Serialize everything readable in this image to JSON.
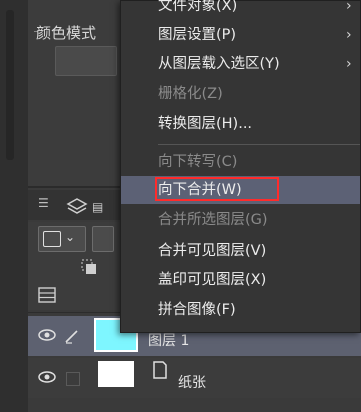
{
  "property_panel": {
    "color_mode_label": "颜色模式"
  },
  "layer_panel": {
    "layers": [
      {
        "name": "图层 1",
        "selected": true,
        "thumbnail_color": "#7ef6ff",
        "visible": true
      },
      {
        "name": "纸张",
        "selected": false,
        "thumbnail_color": "#ffffff",
        "visible": true
      }
    ]
  },
  "context_menu": {
    "items": [
      {
        "label": "文件对象(X)",
        "enabled": true,
        "submenu": true
      },
      {
        "label": "图层设置(P)",
        "enabled": true,
        "submenu": true
      },
      {
        "label": "从图层载入选区(Y)",
        "enabled": true,
        "submenu": true
      },
      {
        "label": "栅格化(Z)",
        "enabled": false,
        "submenu": false
      },
      {
        "label": "转换图层(H)...",
        "enabled": true,
        "submenu": false
      },
      {
        "label": "向下转写(C)",
        "enabled": false,
        "submenu": false
      },
      {
        "label": "向下合并(W)",
        "enabled": true,
        "submenu": false,
        "highlighted": true
      },
      {
        "label": "合并所选图层(G)",
        "enabled": false,
        "submenu": false
      },
      {
        "label": "合并可见图层(V)",
        "enabled": true,
        "submenu": false
      },
      {
        "label": "盖印可见图层(X)",
        "enabled": true,
        "submenu": false
      },
      {
        "label": "拼合图像(F)",
        "enabled": true,
        "submenu": false
      }
    ],
    "submenu_arrow": "›"
  },
  "colors": {
    "highlight_bg": "#5c6175",
    "highlight_border": "#ff2b2b",
    "menu_bg": "#353535",
    "panel_bg": "#3c3c3c"
  }
}
